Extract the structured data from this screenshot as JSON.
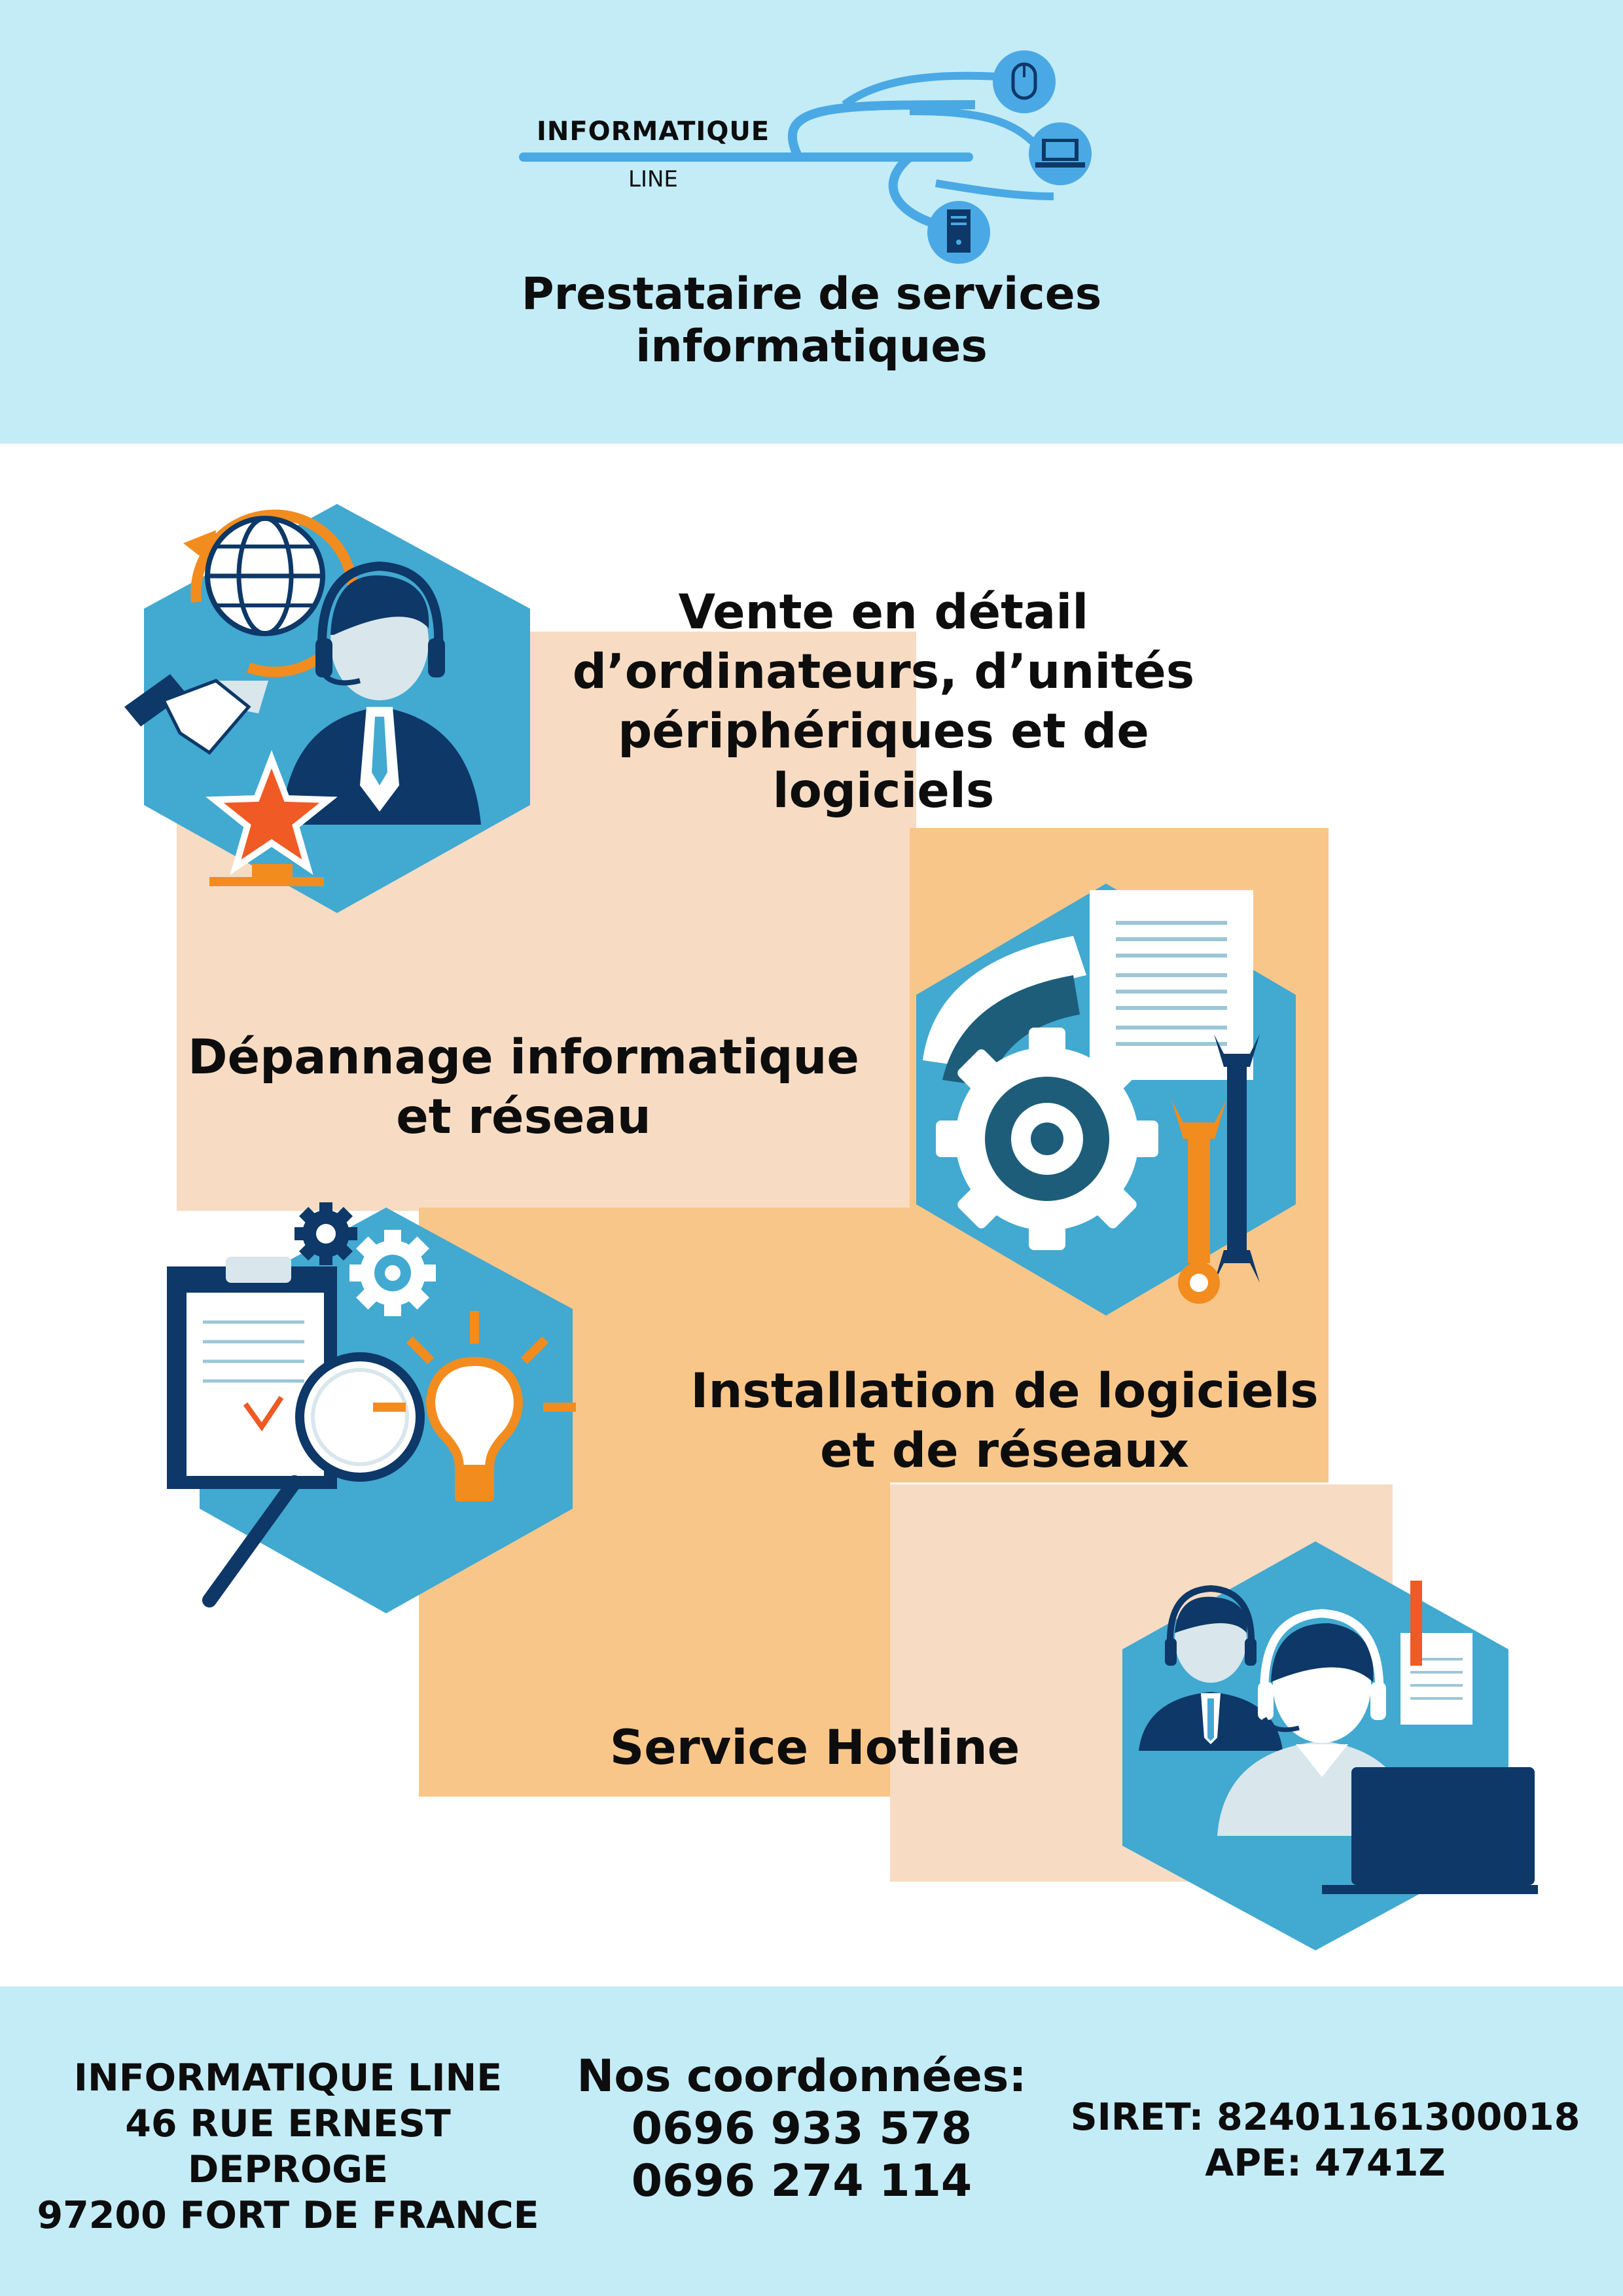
{
  "header": {
    "logo_word1": "INFORMATIQUE",
    "logo_word2": "LINE",
    "tagline_line1": "Prestataire de services",
    "tagline_line2": "informatiques"
  },
  "services": [
    {
      "lines": [
        "Vente en détail",
        "d’ordinateurs, d’unités",
        "périphériques et de",
        "logiciels"
      ],
      "icon": "customer-service-globe-icon"
    },
    {
      "lines": [
        "Dépannage informatique",
        "et réseau"
      ],
      "icon": "repair-gear-wrench-icon"
    },
    {
      "lines": [
        "Installation de logiciels",
        "et de réseaux"
      ],
      "icon": "clipboard-magnifier-bulb-icon"
    },
    {
      "lines": [
        "Service Hotline"
      ],
      "icon": "hotline-operators-icon"
    }
  ],
  "footer": {
    "company": [
      "INFORMATIQUE LINE",
      "46 RUE ERNEST",
      "DEPROGE",
      "97200 FORT DE FRANCE"
    ],
    "contact_title": "Nos coordonnées:",
    "phones": [
      "0696 933 578",
      "0696 274 114"
    ],
    "siret": "SIRET: 82401161300018",
    "ape": "APE: 4741Z"
  },
  "colors": {
    "band": "#c3ecf7",
    "peach_light": "#f7dcc3",
    "peach_dark": "#f9c68a",
    "hex_blue": "#42a9d1",
    "navy": "#0d3868",
    "orange": "#f28c1e"
  }
}
